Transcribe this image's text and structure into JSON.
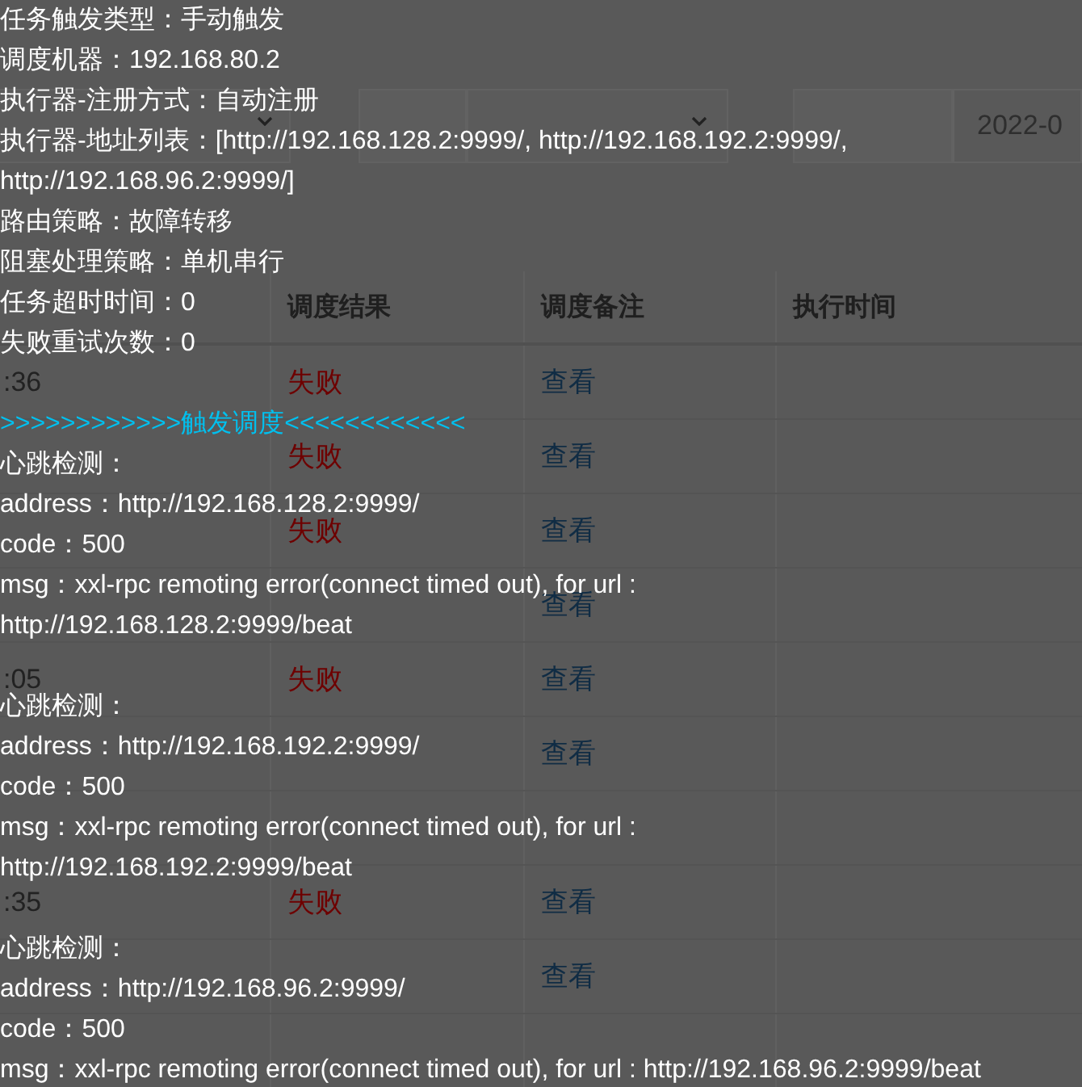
{
  "filters": {
    "time_value": "2022-0"
  },
  "table": {
    "columns": [
      "调度结果",
      "调度备注",
      "执行时间"
    ],
    "rows": [
      {
        "time": ":36",
        "result": "失败",
        "note": "查看"
      },
      {
        "result": "失败",
        "note": "查看"
      },
      {
        "result": "失败",
        "note": "查看"
      },
      {
        "note": "查看"
      },
      {
        "time": ":05",
        "result": "失败",
        "note": "查看"
      },
      {
        "note": "查看"
      },
      {},
      {
        "time": ":35",
        "result": "失败",
        "note": "查看"
      },
      {
        "note": "查看"
      },
      {}
    ]
  },
  "log": [
    {
      "kind": "text",
      "text": "任务触发类型：手动触发"
    },
    {
      "kind": "text",
      "text": "调度机器：192.168.80.2"
    },
    {
      "kind": "text",
      "text": "执行器-注册方式：自动注册"
    },
    {
      "kind": "text",
      "text": "执行器-地址列表：[http://192.168.128.2:9999/, http://192.168.192.2:9999/,"
    },
    {
      "kind": "text",
      "text": "http://192.168.96.2:9999/]"
    },
    {
      "kind": "text",
      "text": "路由策略：故障转移"
    },
    {
      "kind": "text",
      "text": "阻塞处理策略：单机串行"
    },
    {
      "kind": "text",
      "text": "任务超时时间：0"
    },
    {
      "kind": "text",
      "text": "失败重试次数：0"
    },
    {
      "kind": "blank"
    },
    {
      "kind": "trigger",
      "text": ">>>>>>>>>>>>触发调度<<<<<<<<<<<<"
    },
    {
      "kind": "text",
      "text": "心跳检测："
    },
    {
      "kind": "text",
      "text": "address：http://192.168.128.2:9999/"
    },
    {
      "kind": "text",
      "text": "code：500"
    },
    {
      "kind": "text",
      "text": "msg：xxl-rpc remoting error(connect timed out), for url :"
    },
    {
      "kind": "text",
      "text": "http://192.168.128.2:9999/beat"
    },
    {
      "kind": "blank"
    },
    {
      "kind": "text",
      "text": "心跳检测："
    },
    {
      "kind": "text",
      "text": "address：http://192.168.192.2:9999/"
    },
    {
      "kind": "text",
      "text": "code：500"
    },
    {
      "kind": "text",
      "text": "msg：xxl-rpc remoting error(connect timed out), for url :"
    },
    {
      "kind": "text",
      "text": "http://192.168.192.2:9999/beat"
    },
    {
      "kind": "blank"
    },
    {
      "kind": "text",
      "text": "心跳检测："
    },
    {
      "kind": "text",
      "text": "address：http://192.168.96.2:9999/"
    },
    {
      "kind": "text",
      "text": "code：500"
    },
    {
      "kind": "text",
      "text": "msg：xxl-rpc remoting error(connect timed out), for url : http://192.168.96.2:9999/beat"
    }
  ]
}
